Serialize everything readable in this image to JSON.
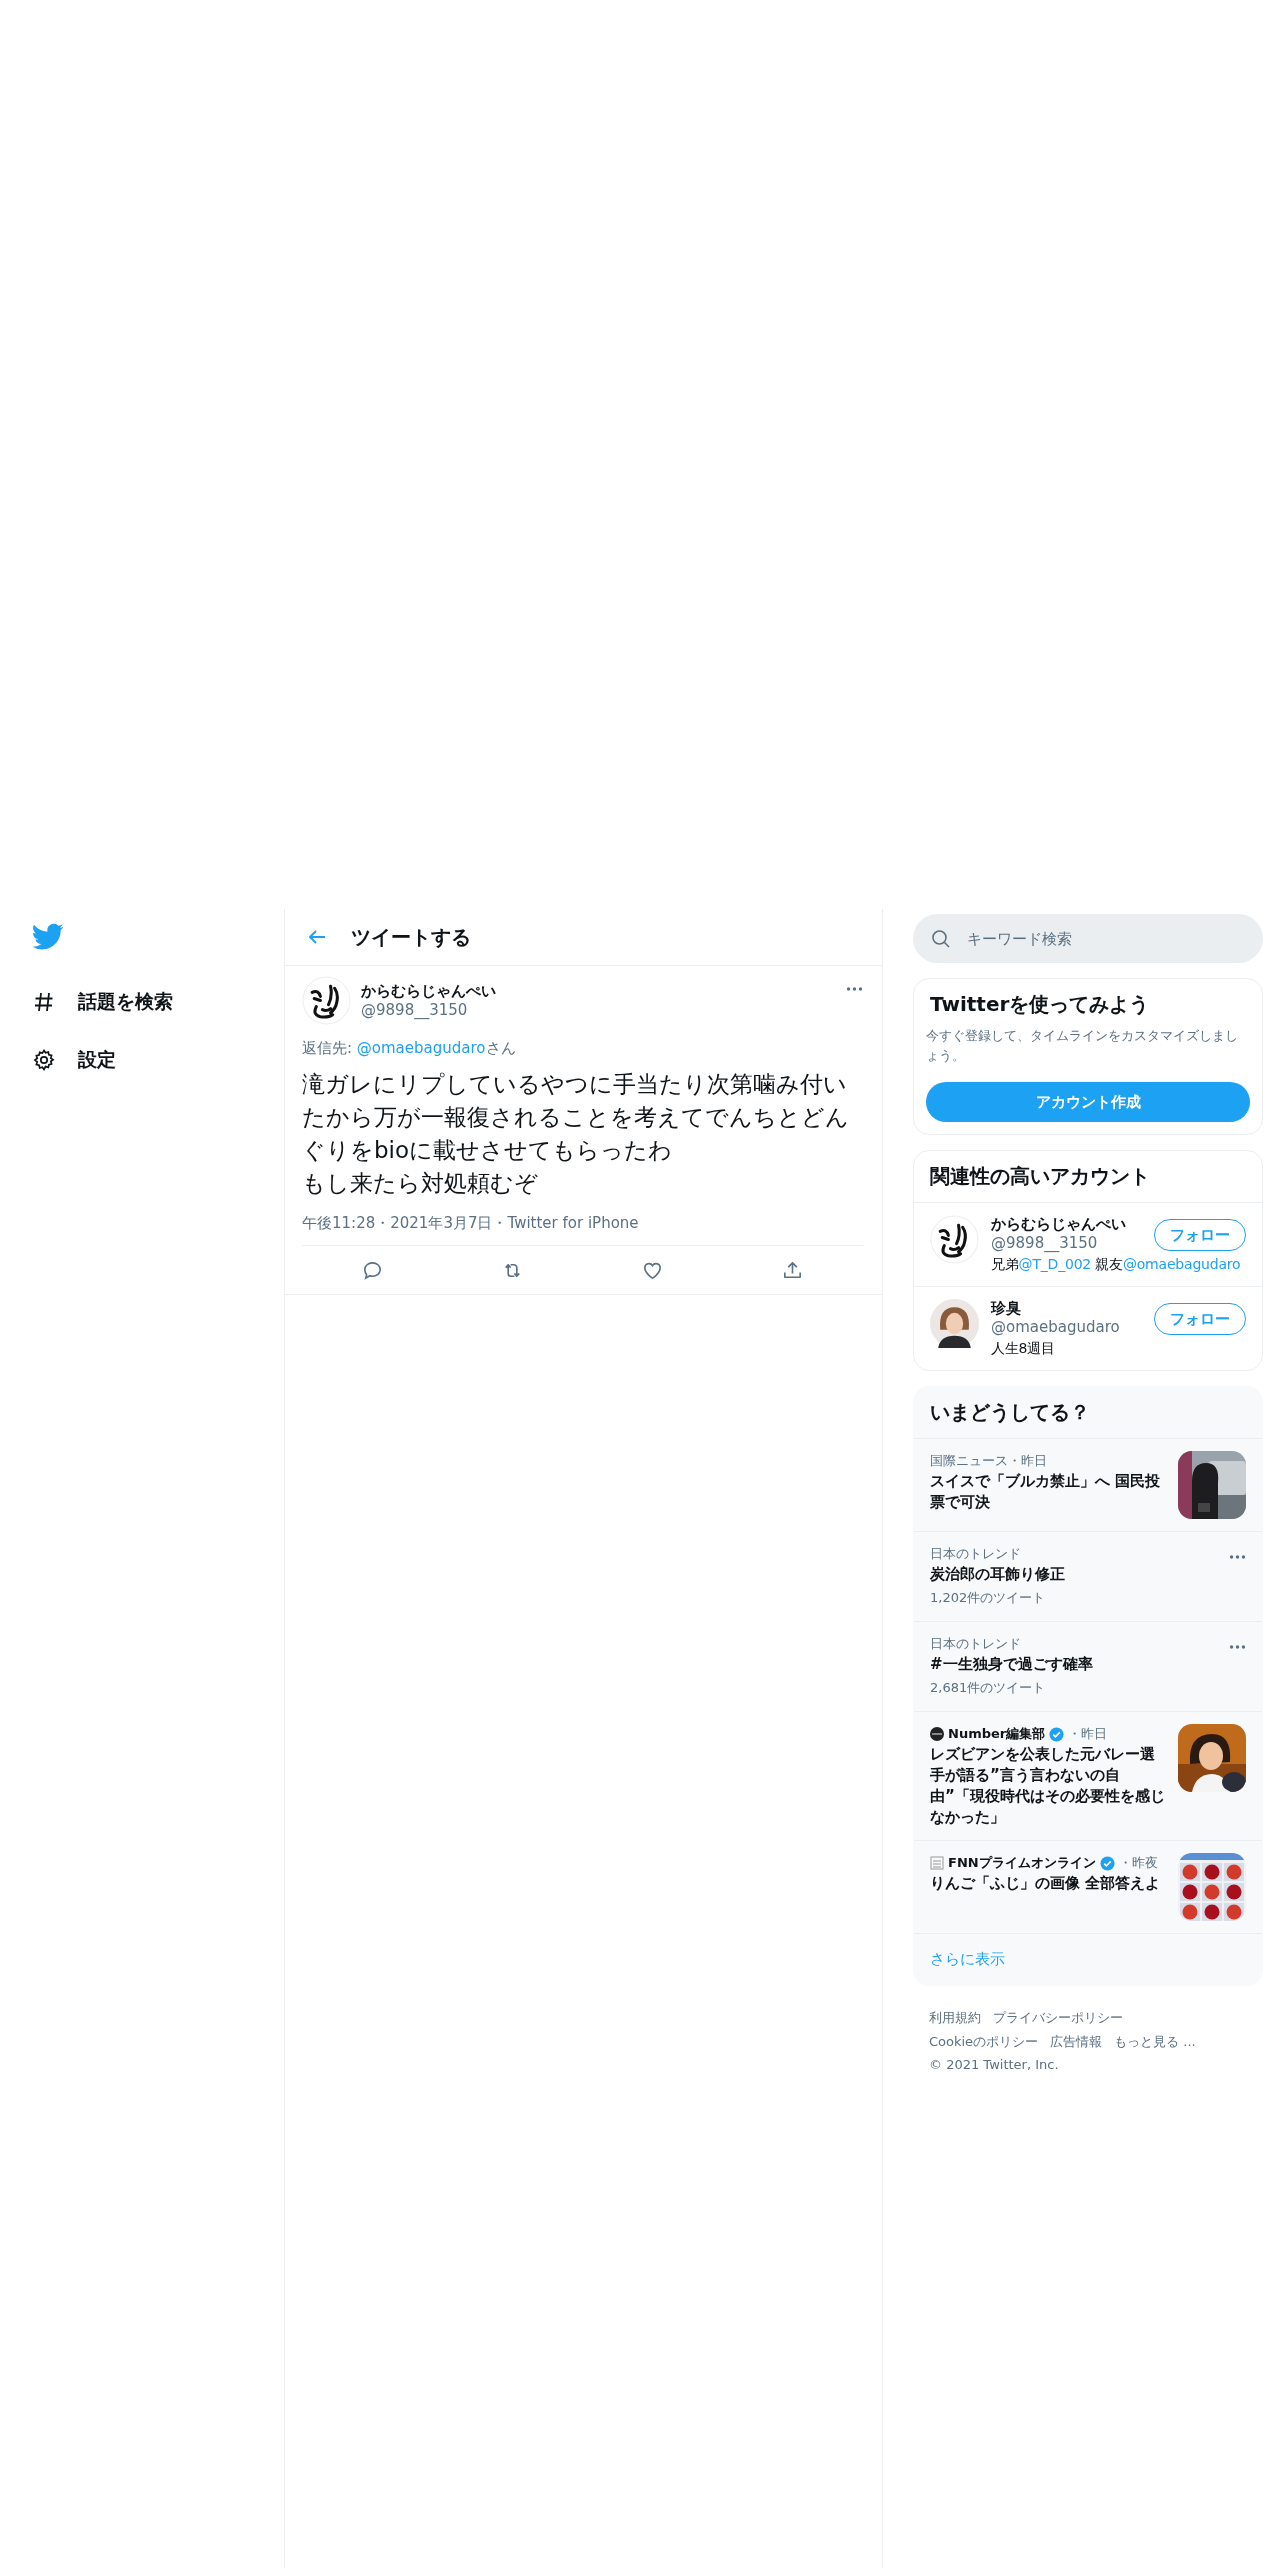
{
  "sidebar": {
    "items": [
      {
        "kind": "explore",
        "label": "話題を検索"
      },
      {
        "kind": "settings",
        "label": "設定"
      }
    ]
  },
  "header": {
    "title": "ツイートする"
  },
  "tweet": {
    "author": {
      "name": "からむらじゃんぺい",
      "handle": "@9898__3150"
    },
    "reply_to": {
      "prefix": "返信先: ",
      "handle": "@omaebagudaro",
      "suffix": "さん"
    },
    "body": [
      "滝ガレにリプしているやつに手当たり次第噛み付いたから万が一報復されることを考えてでんちとどんぐりをbioに載せさせてもらったわ",
      "もし来たら対処頼むぞ"
    ],
    "meta": "午後11:28・2021年3月7日・Twitter for iPhone",
    "actions": [
      {
        "kind": "reply"
      },
      {
        "kind": "retweet"
      },
      {
        "kind": "like"
      },
      {
        "kind": "share"
      }
    ]
  },
  "search": {
    "placeholder": "キーワード検索"
  },
  "signup": {
    "title": "Twitterを使ってみよう",
    "text": "今すぐ登録して、タイムラインをカスタマイズしましょう。",
    "button": "アカウント作成"
  },
  "related": {
    "title": "関連性の高いアカウント",
    "accounts": [
      {
        "kind": "calligraphy",
        "name": "からむらじゃんぺい",
        "handle": "@9898__3150",
        "bio": [
          {
            "text": "兄弟",
            "link": false
          },
          {
            "text": "@T_D_002",
            "link": true
          },
          {
            "text": " 親友",
            "link": false
          },
          {
            "text": "@omaebagudaro",
            "link": true
          }
        ],
        "button": "フォロー"
      },
      {
        "name": "珍臭",
        "handle": "@omaebagudaro",
        "bio": [
          {
            "text": "人生8週目",
            "link": false
          }
        ],
        "button": "フォロー"
      }
    ]
  },
  "trends": {
    "title": "いまどうしてる？",
    "items": [
      {
        "kind": "news",
        "category": "国際ニュース・昨日",
        "headline": "スイスで「ブルカ禁止」へ 国民投票で可決"
      },
      {
        "kind": "trend",
        "category": "日本のトレンド",
        "headline": "炭治郎の耳飾り修正",
        "count": "1,202件のツイート"
      },
      {
        "kind": "trend",
        "category": "日本のトレンド",
        "headline": "#一生独身で過ごす確率",
        "count": "2,681件のツイート"
      },
      {
        "kind": "article",
        "source": "Number編集部",
        "verified": true,
        "time": "・昨日",
        "headline": "レズビアンを公表した元バレー選手が語る”言う言わないの自由”「現役時代はその必要性を感じなかった」"
      },
      {
        "kind": "article",
        "source": "FNNプライムオンライン",
        "verified": true,
        "time": "・昨夜",
        "headline": "りんご「ふじ」の画像 全部答えよ"
      }
    ],
    "more": "さらに表示"
  },
  "footer": {
    "lines": [
      [
        "利用規約",
        "プライバシーポリシー"
      ],
      [
        "Cookieのポリシー",
        "広告情報",
        "もっと見る ..."
      ]
    ],
    "copyright": "© 2021 Twitter, Inc."
  }
}
